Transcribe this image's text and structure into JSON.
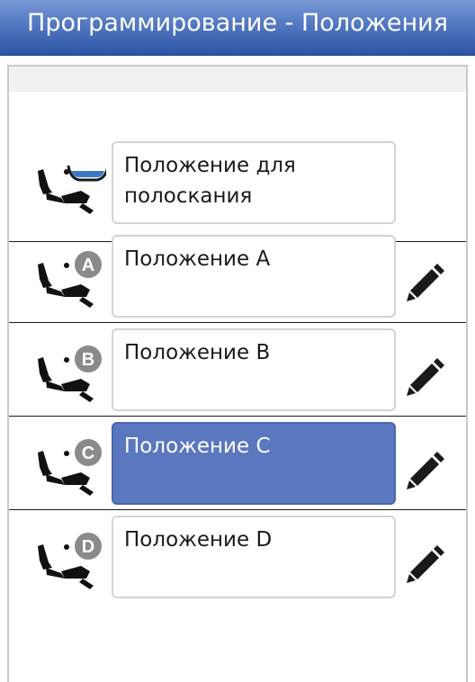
{
  "header": {
    "title": "Программирование - Положения"
  },
  "positions": [
    {
      "label": "Положение для полоскания",
      "icon": "chair-rinse-icon",
      "selected": false,
      "editable": false
    },
    {
      "label": "Положение A",
      "badge": "A",
      "icon": "chair-position-a-icon",
      "selected": false,
      "editable": true
    },
    {
      "label": "Положение B",
      "badge": "B",
      "icon": "chair-position-b-icon",
      "selected": false,
      "editable": true
    },
    {
      "label": "Положение C",
      "badge": "C",
      "icon": "chair-position-c-icon",
      "selected": true,
      "editable": true
    },
    {
      "label": "Положение D",
      "badge": "D",
      "icon": "chair-position-d-icon",
      "selected": false,
      "editable": true
    }
  ],
  "colors": {
    "title_bar": "#3f64b3",
    "selected_fill": "#5a77c0",
    "badge_fill": "#8a8a8a",
    "water_fill": "#3a78c8"
  },
  "edit_icon": "pencil-icon"
}
